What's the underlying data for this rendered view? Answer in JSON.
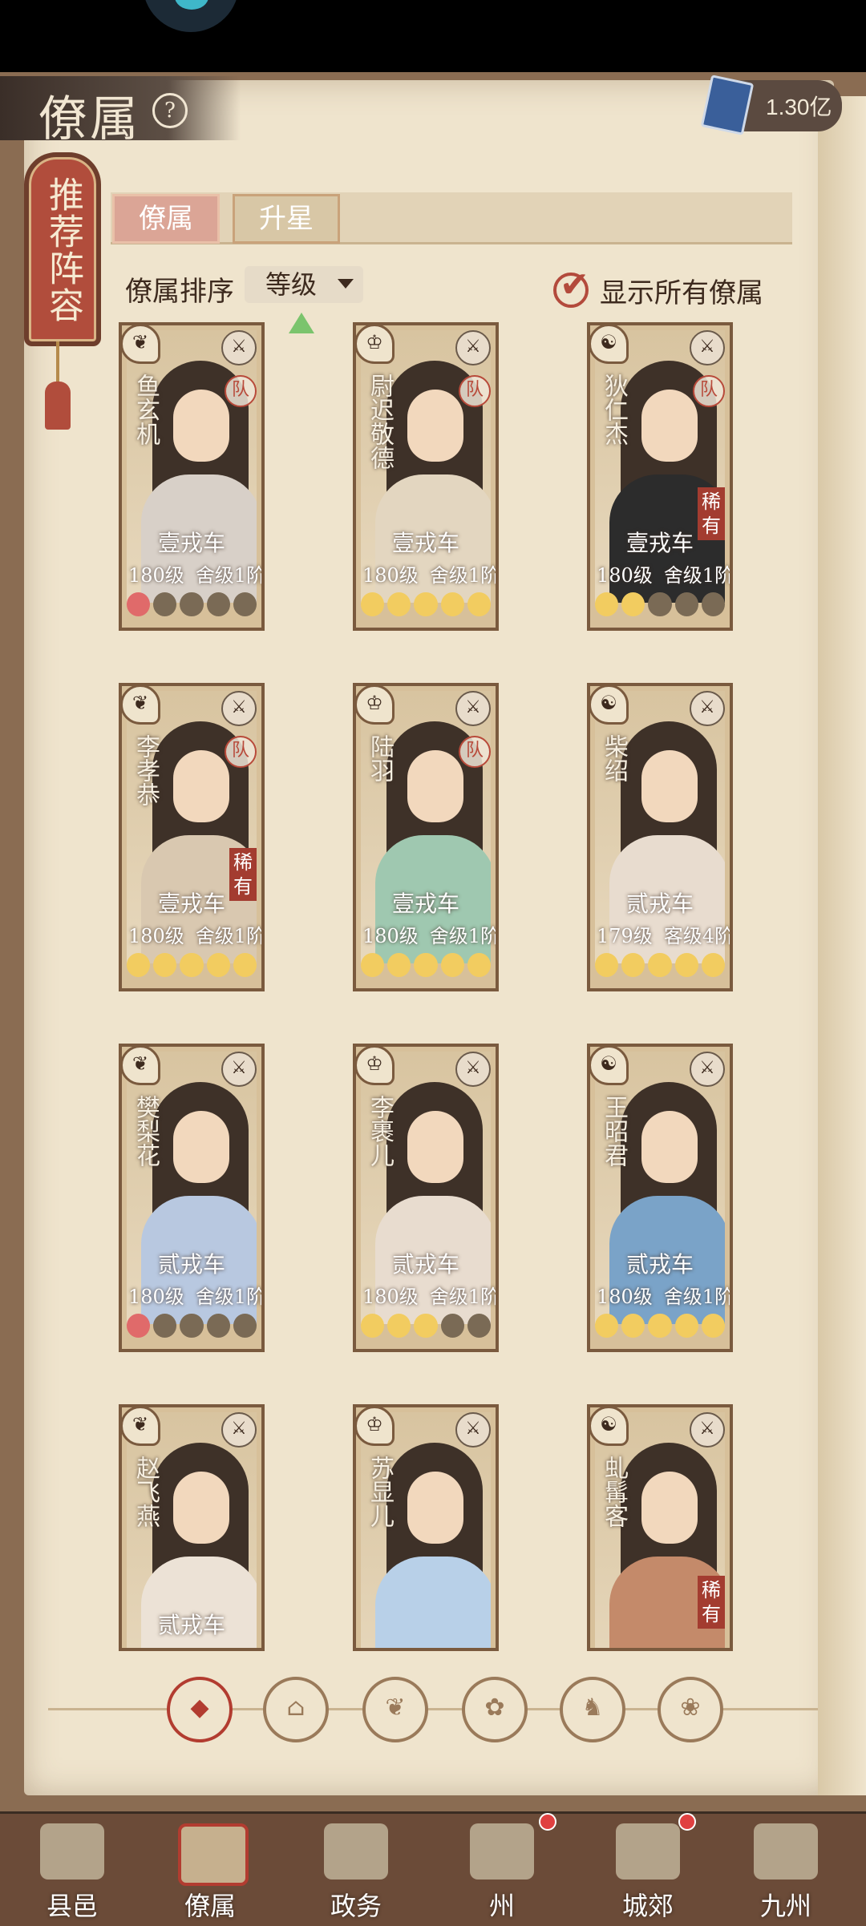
{
  "header": {
    "title": "僚属",
    "help_icon": "?",
    "currency_value": "1.30亿"
  },
  "banner": {
    "text": "推荐阵容"
  },
  "tabs": [
    {
      "label": "僚属",
      "active": true
    },
    {
      "label": "升星",
      "active": false
    }
  ],
  "sort": {
    "label": "僚属排序",
    "value": "等级"
  },
  "show_all": {
    "label": "显示所有僚属",
    "checked": true
  },
  "cards": [
    {
      "name": "鱼玄机",
      "rank": "壹戎车",
      "level": "180级",
      "house": "舍级1阶",
      "team": "队",
      "rare": "",
      "moons": [
        "red",
        "off",
        "off",
        "off",
        "off"
      ],
      "robe": "#d8d0c8"
    },
    {
      "name": "尉迟敬德",
      "rank": "壹戎车",
      "level": "180级",
      "house": "舍级1阶",
      "team": "队",
      "rare": "",
      "moons": [
        "on",
        "on",
        "on",
        "on",
        "on"
      ],
      "robe": "#e3d6c0"
    },
    {
      "name": "狄仁杰",
      "rank": "壹戎车",
      "level": "180级",
      "house": "舍级1阶",
      "team": "队",
      "rare": "稀有",
      "moons": [
        "on",
        "on",
        "off",
        "off",
        "off"
      ],
      "robe": "#2c2c2c"
    },
    {
      "name": "李孝恭",
      "rank": "壹戎车",
      "level": "180级",
      "house": "舍级1阶",
      "team": "队",
      "rare": "稀有",
      "moons": [
        "on",
        "on",
        "on",
        "on",
        "on"
      ],
      "robe": "#d9c8b0"
    },
    {
      "name": "陆羽",
      "rank": "壹戎车",
      "level": "180级",
      "house": "舍级1阶",
      "team": "队",
      "rare": "",
      "moons": [
        "on",
        "on",
        "on",
        "on",
        "on"
      ],
      "robe": "#9fc8b0"
    },
    {
      "name": "柴绍",
      "rank": "贰戎车",
      "level": "179级",
      "house": "客级4阶",
      "team": "",
      "rare": "",
      "moons": [
        "on",
        "on",
        "on",
        "on",
        "on"
      ],
      "robe": "#e8dccf"
    },
    {
      "name": "樊梨花",
      "rank": "贰戎车",
      "level": "180级",
      "house": "舍级1阶",
      "team": "",
      "rare": "",
      "moons": [
        "red",
        "off",
        "off",
        "off",
        "off"
      ],
      "robe": "#b8c8e0"
    },
    {
      "name": "李裹儿",
      "rank": "贰戎车",
      "level": "180级",
      "house": "舍级1阶",
      "team": "",
      "rare": "",
      "moons": [
        "on",
        "on",
        "on",
        "off",
        "off"
      ],
      "robe": "#e8dccf"
    },
    {
      "name": "王昭君",
      "rank": "贰戎车",
      "level": "180级",
      "house": "舍级1阶",
      "team": "",
      "rare": "",
      "moons": [
        "on",
        "on",
        "on",
        "on",
        "on"
      ],
      "robe": "#7aa3c8"
    },
    {
      "name": "赵飞燕",
      "rank": "贰戎车",
      "level": "",
      "house": "",
      "team": "",
      "rare": "",
      "moons": [],
      "robe": "#ece2d6"
    },
    {
      "name": "苏显儿",
      "rank": "",
      "level": "",
      "house": "",
      "team": "",
      "rare": "",
      "moons": [],
      "robe": "#b8d0e8"
    },
    {
      "name": "虬髯客",
      "rank": "",
      "level": "",
      "house": "",
      "team": "",
      "rare": "稀有",
      "moons": [],
      "robe": "#c48a6a"
    }
  ],
  "nav": [
    {
      "label": "县邑",
      "dot": false
    },
    {
      "label": "僚属",
      "dot": false,
      "active": true
    },
    {
      "label": "政务",
      "dot": false
    },
    {
      "label": "州",
      "dot": true
    },
    {
      "label": "城郊",
      "dot": true
    },
    {
      "label": "九州",
      "dot": false
    }
  ]
}
